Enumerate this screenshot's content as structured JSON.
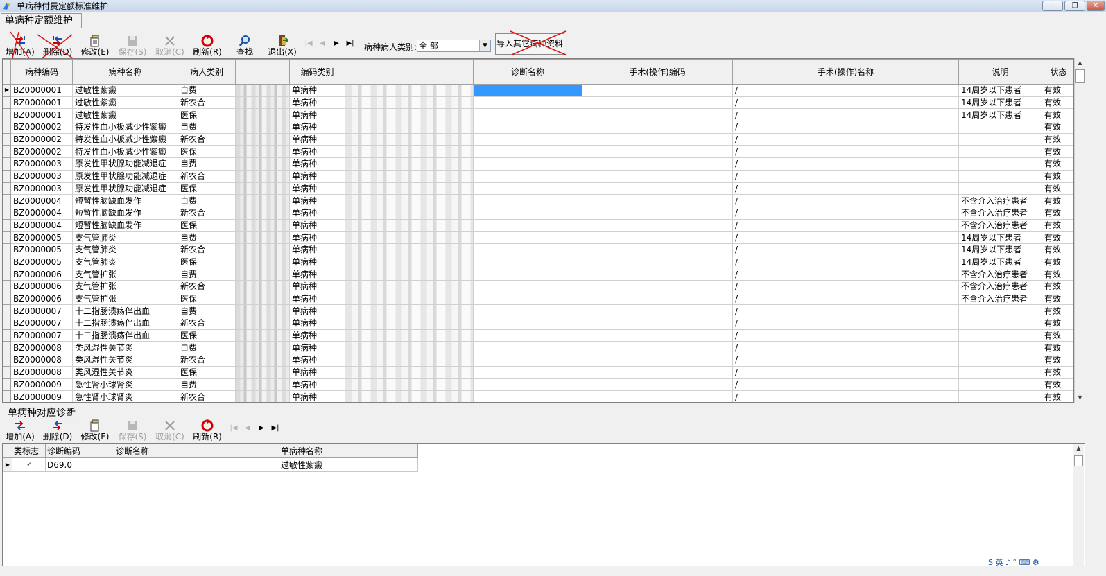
{
  "window": {
    "title": "单病种付费定额标准维护",
    "min": "–",
    "max": "❐",
    "close": "✕"
  },
  "tab": "单病种定额维护",
  "toolbar1": {
    "buttons": [
      {
        "label": "增加(A)",
        "icon": "add-icon",
        "disabled": false
      },
      {
        "label": "删除(D)",
        "icon": "delete-icon",
        "disabled": false
      },
      {
        "label": "修改(E)",
        "icon": "edit-icon",
        "disabled": false
      },
      {
        "label": "保存(S)",
        "icon": "save-icon",
        "disabled": true
      },
      {
        "label": "取消(C)",
        "icon": "cancel-icon",
        "disabled": true
      },
      {
        "label": "刷新(R)",
        "icon": "refresh-icon",
        "disabled": false
      },
      {
        "label": "查找",
        "icon": "find-icon",
        "disabled": false
      },
      {
        "label": "退出(X)",
        "icon": "exit-icon",
        "disabled": false
      }
    ],
    "nav": [
      "|◀",
      "◀",
      "▶",
      "▶|"
    ],
    "combo_label": "病种病人类别:",
    "combo_value": "全 部",
    "import_label": "导入其它病种资料"
  },
  "grid1": {
    "columns": [
      "病种编码",
      "病种名称",
      "病人类别",
      "",
      "编码类别",
      "",
      "诊断名称",
      "手术(操作)编码",
      "手术(操作)名称",
      "说明",
      "状态"
    ],
    "rows": [
      [
        "BZ0000001",
        "过敏性紫癜",
        "自费",
        "单病种",
        "/",
        "14周岁以下患者",
        "有效"
      ],
      [
        "BZ0000001",
        "过敏性紫癜",
        "新农合",
        "单病种",
        "/",
        "14周岁以下患者",
        "有效"
      ],
      [
        "BZ0000001",
        "过敏性紫癜",
        "医保",
        "单病种",
        "/",
        "14周岁以下患者",
        "有效"
      ],
      [
        "BZ0000002",
        "特发性血小板减少性紫癜",
        "自费",
        "单病种",
        "/",
        "",
        "有效"
      ],
      [
        "BZ0000002",
        "特发性血小板减少性紫癜",
        "新农合",
        "单病种",
        "/",
        "",
        "有效"
      ],
      [
        "BZ0000002",
        "特发性血小板减少性紫癜",
        "医保",
        "单病种",
        "/",
        "",
        "有效"
      ],
      [
        "BZ0000003",
        "原发性甲状腺功能减退症",
        "自费",
        "单病种",
        "/",
        "",
        "有效"
      ],
      [
        "BZ0000003",
        "原发性甲状腺功能减退症",
        "新农合",
        "单病种",
        "/",
        "",
        "有效"
      ],
      [
        "BZ0000003",
        "原发性甲状腺功能减退症",
        "医保",
        "单病种",
        "/",
        "",
        "有效"
      ],
      [
        "BZ0000004",
        "短暂性脑缺血发作",
        "自费",
        "单病种",
        "/",
        "不含介入治疗患者",
        "有效"
      ],
      [
        "BZ0000004",
        "短暂性脑缺血发作",
        "新农合",
        "单病种",
        "/",
        "不含介入治疗患者",
        "有效"
      ],
      [
        "BZ0000004",
        "短暂性脑缺血发作",
        "医保",
        "单病种",
        "/",
        "不含介入治疗患者",
        "有效"
      ],
      [
        "BZ0000005",
        "支气管肺炎",
        "自费",
        "单病种",
        "/",
        "14周岁以下患者",
        "有效"
      ],
      [
        "BZ0000005",
        "支气管肺炎",
        "新农合",
        "单病种",
        "/",
        "14周岁以下患者",
        "有效"
      ],
      [
        "BZ0000005",
        "支气管肺炎",
        "医保",
        "单病种",
        "/",
        "14周岁以下患者",
        "有效"
      ],
      [
        "BZ0000006",
        "支气管扩张",
        "自费",
        "单病种",
        "/",
        "不含介入治疗患者",
        "有效"
      ],
      [
        "BZ0000006",
        "支气管扩张",
        "新农合",
        "单病种",
        "/",
        "不含介入治疗患者",
        "有效"
      ],
      [
        "BZ0000006",
        "支气管扩张",
        "医保",
        "单病种",
        "/",
        "不含介入治疗患者",
        "有效"
      ],
      [
        "BZ0000007",
        "十二指肠溃疡伴出血",
        "自费",
        "单病种",
        "/",
        "",
        "有效"
      ],
      [
        "BZ0000007",
        "十二指肠溃疡伴出血",
        "新农合",
        "单病种",
        "/",
        "",
        "有效"
      ],
      [
        "BZ0000007",
        "十二指肠溃疡伴出血",
        "医保",
        "单病种",
        "/",
        "",
        "有效"
      ],
      [
        "BZ0000008",
        "类风湿性关节炎",
        "自费",
        "单病种",
        "/",
        "",
        "有效"
      ],
      [
        "BZ0000008",
        "类风湿性关节炎",
        "新农合",
        "单病种",
        "/",
        "",
        "有效"
      ],
      [
        "BZ0000008",
        "类风湿性关节炎",
        "医保",
        "单病种",
        "/",
        "",
        "有效"
      ],
      [
        "BZ0000009",
        "急性肾小球肾炎",
        "自费",
        "单病种",
        "/",
        "",
        "有效"
      ],
      [
        "BZ0000009",
        "急性肾小球肾炎",
        "新农合",
        "单病种",
        "/",
        "",
        "有效"
      ]
    ]
  },
  "group_title": "单病种对应诊断",
  "toolbar2": {
    "buttons": [
      {
        "label": "增加(A)",
        "icon": "add-icon",
        "disabled": false
      },
      {
        "label": "删除(D)",
        "icon": "delete-icon",
        "disabled": false
      },
      {
        "label": "修改(E)",
        "icon": "edit-icon",
        "disabled": false
      },
      {
        "label": "保存(S)",
        "icon": "save-icon",
        "disabled": true
      },
      {
        "label": "取消(C)",
        "icon": "cancel-icon",
        "disabled": true
      },
      {
        "label": "刷新(R)",
        "icon": "refresh-icon",
        "disabled": false
      }
    ],
    "nav": [
      "|◀",
      "◀",
      "▶",
      "▶|"
    ]
  },
  "grid2": {
    "columns": [
      "类标志",
      "诊断编码",
      "诊断名称",
      "单病种名称"
    ],
    "rows": [
      {
        "checked": "✓",
        "code": "D69.0",
        "name": "",
        "disease": "过敏性紫癜"
      }
    ]
  },
  "tray": "S 英 ♪ ° ⌨ ⚙"
}
